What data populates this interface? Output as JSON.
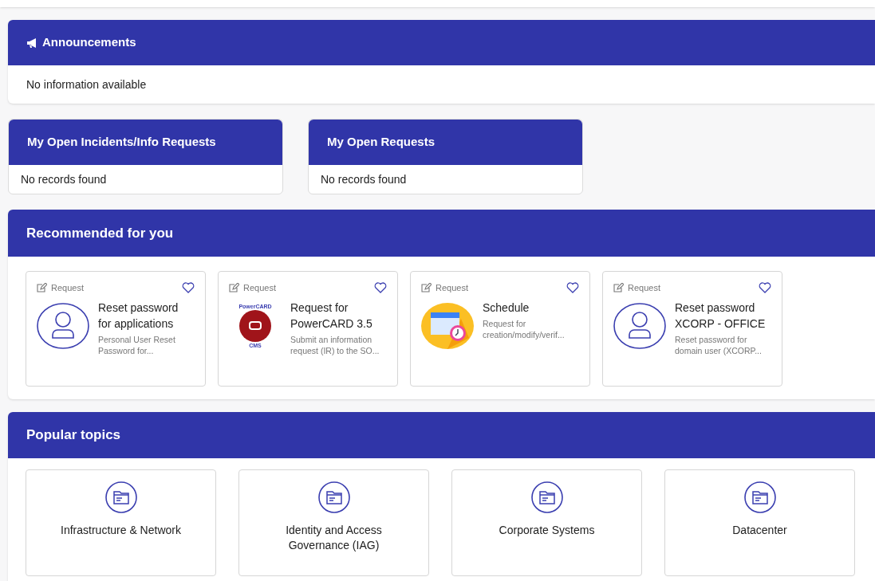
{
  "announcements": {
    "title": "Announcements",
    "message": "No information available"
  },
  "open_panels": [
    {
      "title": "My Open Incidents/Info Requests",
      "message": "No records found"
    },
    {
      "title": "My Open Requests",
      "message": "No records found"
    }
  ],
  "recommended": {
    "title": "Recommended for you",
    "items": [
      {
        "type": "Request",
        "title": "Reset password for applications",
        "description": "Personal User Reset Password for...",
        "kind": "user"
      },
      {
        "type": "Request",
        "title": "Request for PowerCARD 3.5",
        "description": "Submit an information request (IR) to the SO...",
        "kind": "powercard",
        "logo_top": "PowerCARD",
        "logo_bottom": "CMS"
      },
      {
        "type": "Request",
        "title": "Schedule",
        "description": "Request for creation/modify/verif...",
        "kind": "calendar"
      },
      {
        "type": "Request",
        "title": "Reset password XCORP - OFFICE",
        "description": "Reset password for domain user (XCORP...",
        "kind": "user"
      }
    ]
  },
  "popular_topics": {
    "title": "Popular topics",
    "items": [
      {
        "label": "Infrastructure & Network"
      },
      {
        "label": "Identity and Access Governance (IAG)"
      },
      {
        "label": "Corporate Systems"
      },
      {
        "label": "Datacenter"
      }
    ]
  }
}
